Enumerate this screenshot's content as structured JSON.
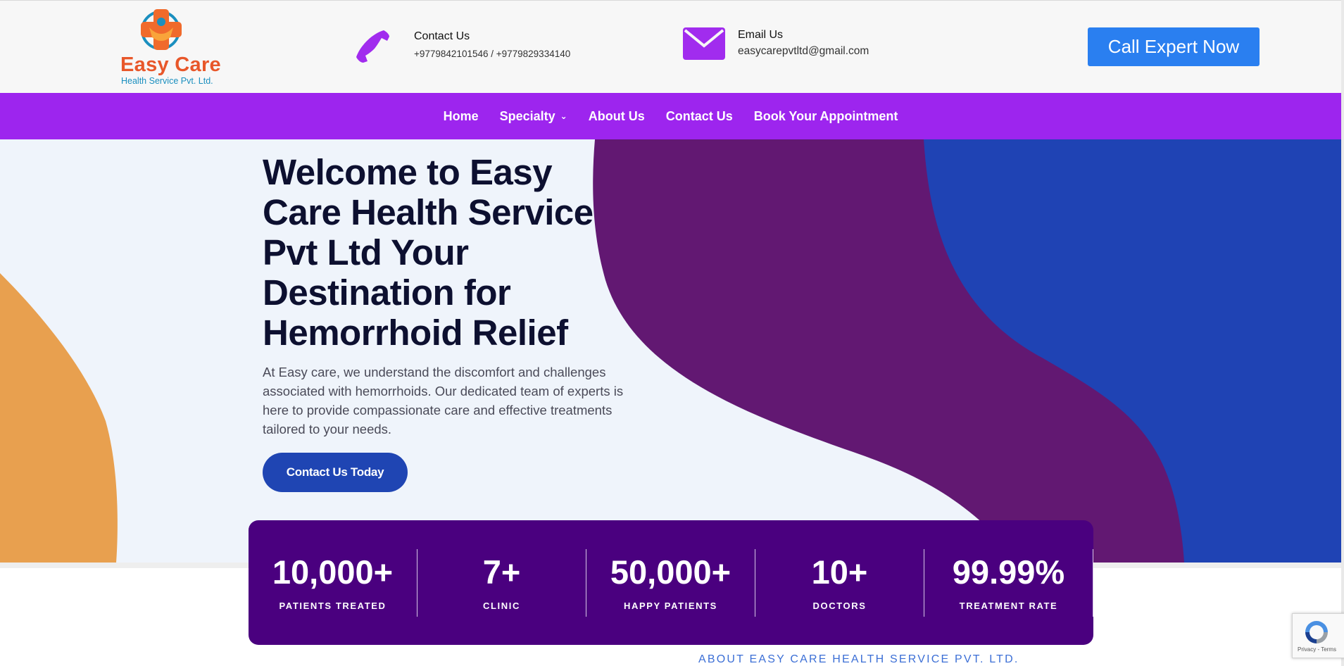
{
  "header": {
    "logo": {
      "name": "Easy Care",
      "subtitle": "Health Service Pvt. Ltd."
    },
    "contact": {
      "title": "Contact Us",
      "phones": "+9779842101546 / +9779829334140",
      "icon": "phone-icon"
    },
    "email": {
      "title": "Email Us",
      "address": "easycarepvtltd@gmail.com",
      "icon": "envelope-icon"
    },
    "cta_label": "Call Expert Now"
  },
  "nav": {
    "items": [
      {
        "label": "Home"
      },
      {
        "label": "Specialty",
        "has_dropdown": true
      },
      {
        "label": "About Us"
      },
      {
        "label": "Contact Us"
      },
      {
        "label": "Book Your Appointment"
      }
    ]
  },
  "hero": {
    "title": "Welcome to Easy Care Health Service Pvt Ltd Your Destination for Hemorrhoid Relief",
    "description": "At Easy care, we understand the discomfort and challenges associated with hemorrhoids. Our dedicated team of experts is here to provide compassionate care and effective treatments tailored to your needs.",
    "button_label": "Contact Us Today"
  },
  "stats": [
    {
      "value": "10,000+",
      "label": "PATIENTS TREATED"
    },
    {
      "value": "7+",
      "label": "CLINIC"
    },
    {
      "value": "50,000+",
      "label": "HAPPY PATIENTS"
    },
    {
      "value": "10+",
      "label": "DOCTORS"
    },
    {
      "value": "99.99%",
      "label": "TREATMENT RATE"
    }
  ],
  "about": {
    "label": "ABOUT EASY CARE HEALTH SERVICE PVT. LTD."
  },
  "recaptcha": {
    "links": "Privacy - Terms"
  },
  "colors": {
    "nav": "#9d25ee",
    "cta": "#2a7ff0",
    "hero_button": "#1f45b3",
    "stats_panel": "#4a007f",
    "wave_purple": "#621872",
    "wave_blue": "#1f43b4",
    "wave_orange": "#e8a04f"
  }
}
